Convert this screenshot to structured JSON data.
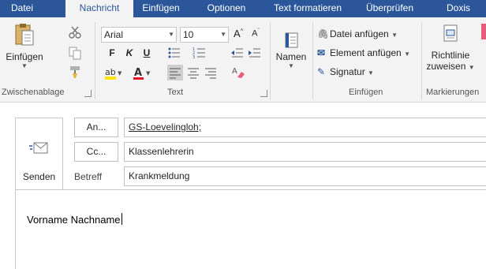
{
  "tabs": [
    {
      "label": "Datei",
      "active": false
    },
    {
      "label": "Nachricht",
      "active": true
    },
    {
      "label": "Einfügen",
      "active": false
    },
    {
      "label": "Optionen",
      "active": false
    },
    {
      "label": "Text formatieren",
      "active": false
    },
    {
      "label": "Überprüfen",
      "active": false
    },
    {
      "label": "Doxis",
      "active": false
    }
  ],
  "ribbon": {
    "clipboard": {
      "paste_label": "Einfügen",
      "group_label": "Zwischenablage"
    },
    "text": {
      "font_name": "Arial",
      "font_size": "10",
      "bold": "F",
      "italic": "K",
      "underline": "U",
      "group_label": "Text"
    },
    "names": {
      "label": "Namen"
    },
    "insert": {
      "attach_file": "Datei anfügen",
      "attach_item": "Element anfügen",
      "signature": "Signatur",
      "group_label": "Einfügen"
    },
    "tags": {
      "policy_line1": "Richtlinie",
      "policy_line2": "zuweisen",
      "group_label": "Markierungen"
    }
  },
  "compose": {
    "send_label": "Senden",
    "to_button": "An...",
    "cc_button": "Cc...",
    "subject_label": "Betreff",
    "to_value": "GS-Loevelingloh;",
    "cc_value": "Klassenlehrerin",
    "subject_value": "Krankmeldung",
    "body_text": "Vorname Nachname"
  },
  "colors": {
    "tab_bar": "#2b579a",
    "ribbon_bg": "#f3f3f3",
    "font_color_accent": "#e81123",
    "highlight_accent": "#ffe500"
  }
}
